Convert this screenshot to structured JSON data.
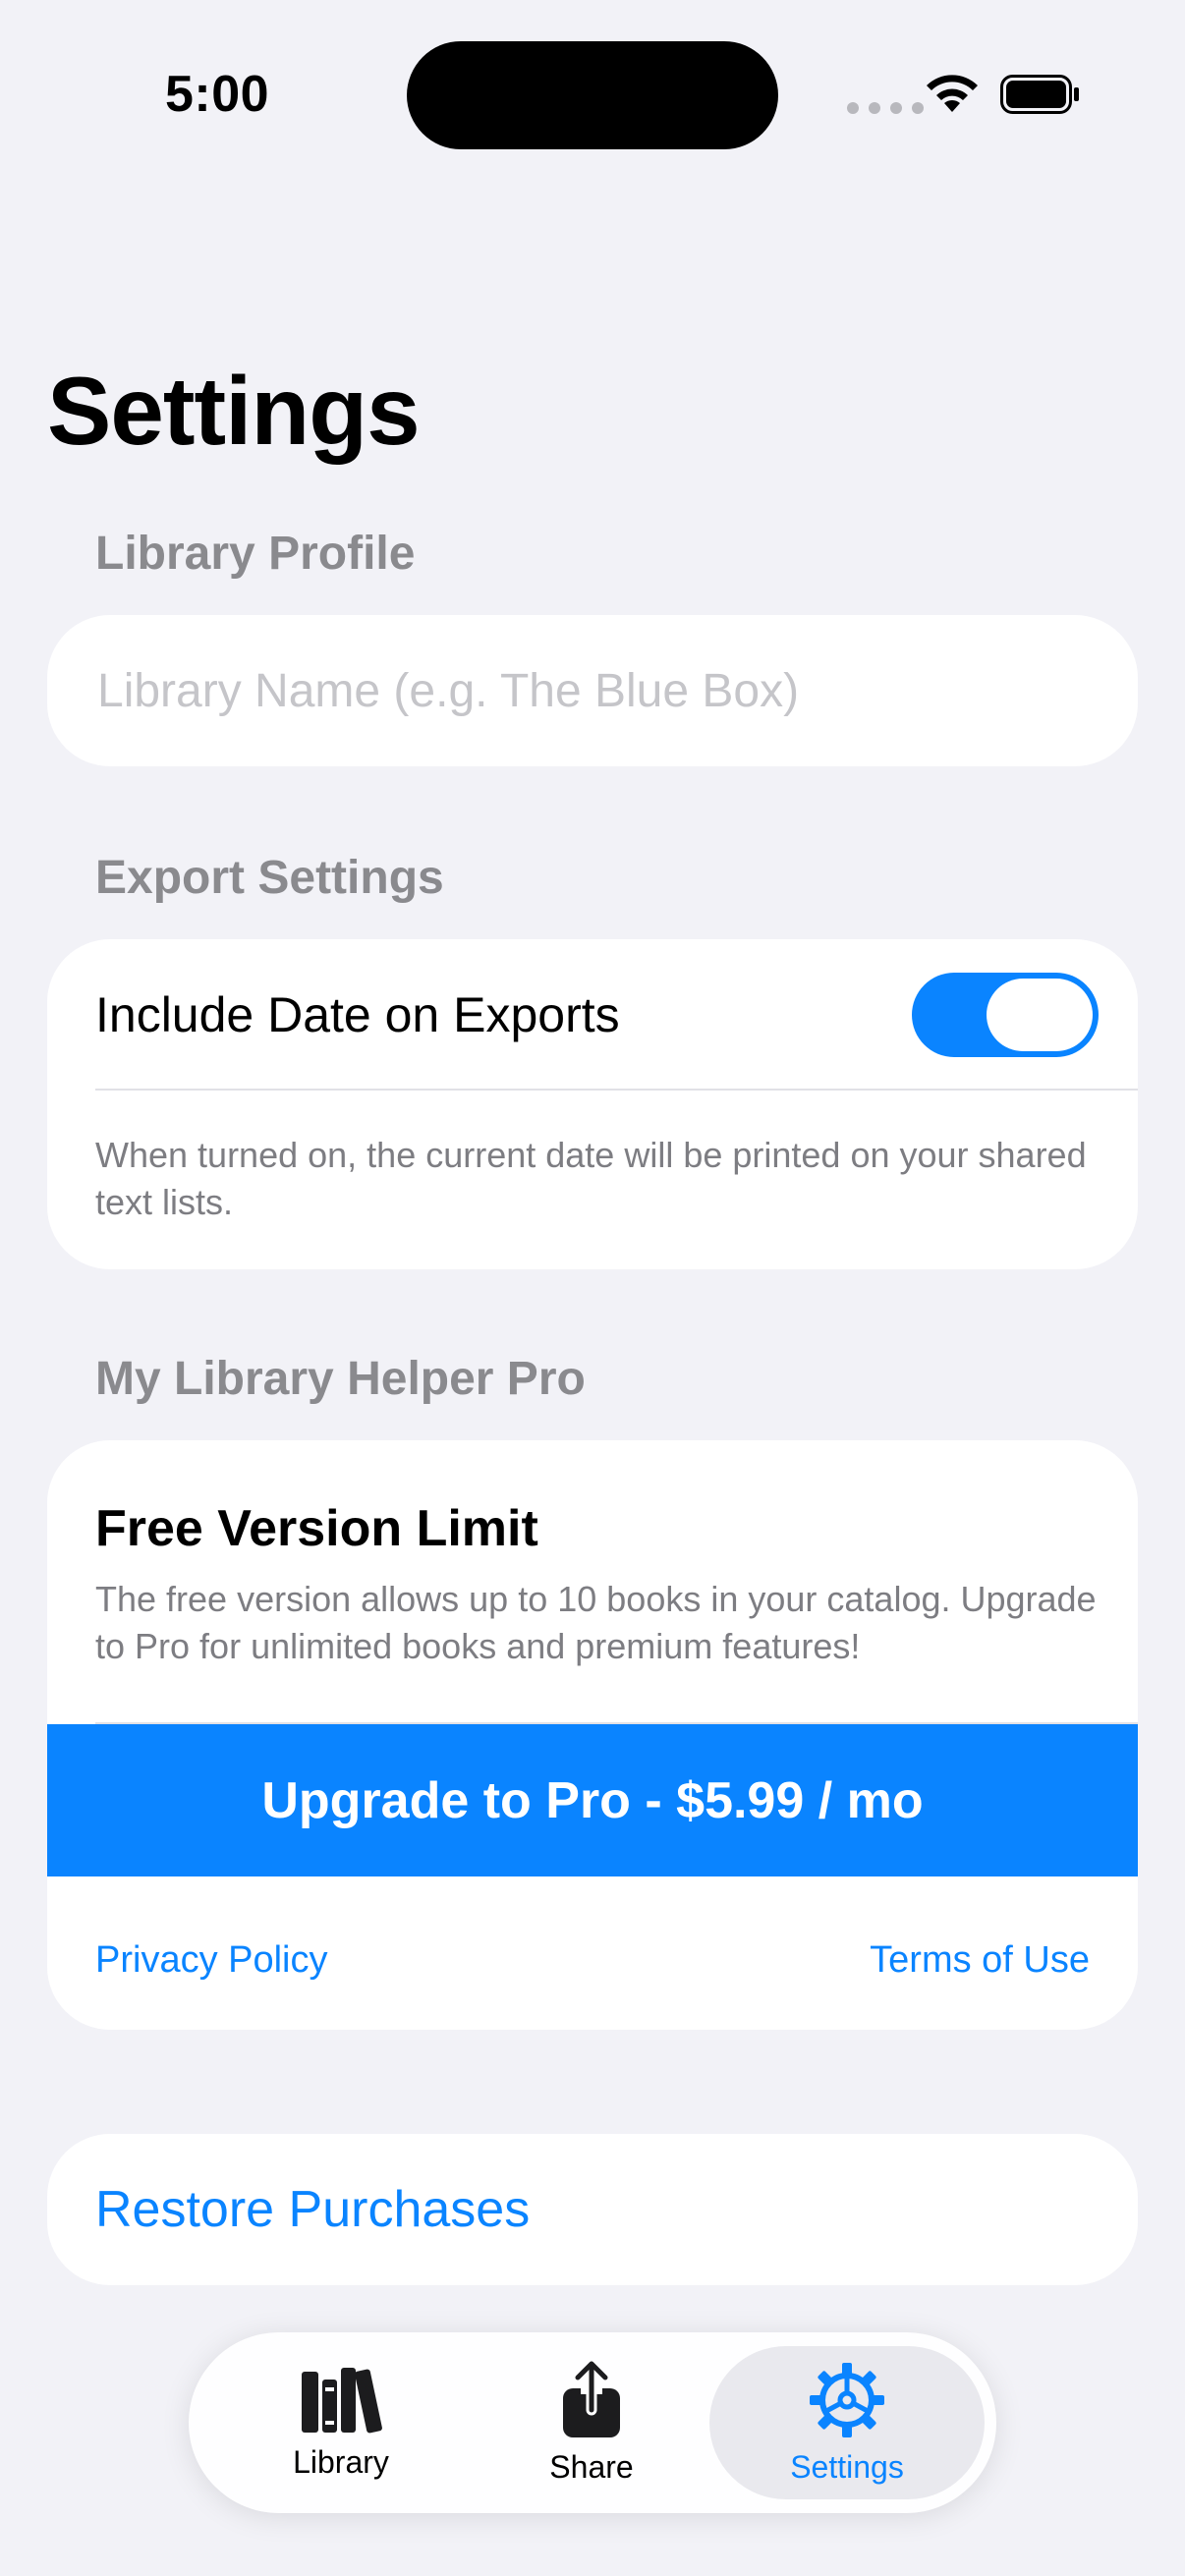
{
  "status_bar": {
    "time": "5:00"
  },
  "page": {
    "title": "Settings"
  },
  "library_profile": {
    "header": "Library Profile",
    "name_placeholder": "Library Name (e.g. The Blue Box)",
    "name_value": ""
  },
  "export_settings": {
    "header": "Export Settings",
    "include_date_label": "Include Date on Exports",
    "include_date_on": true,
    "footnote": "When turned on, the current date will be printed on your shared text lists."
  },
  "pro": {
    "header": "My Library Helper Pro",
    "title": "Free Version Limit",
    "description": "The free version allows up to 10 books in your catalog. Upgrade to Pro for unlimited books and premium features!",
    "upgrade_label": "Upgrade to Pro - $5.99 / mo",
    "privacy_label": "Privacy Policy",
    "terms_label": "Terms of Use"
  },
  "restore": {
    "label": "Restore Purchases"
  },
  "tabbar": {
    "tabs": [
      {
        "label": "Library",
        "icon": "books-icon",
        "active": false
      },
      {
        "label": "Share",
        "icon": "share-icon",
        "active": false
      },
      {
        "label": "Settings",
        "icon": "gear-icon",
        "active": true
      }
    ]
  },
  "colors": {
    "accent": "#0a84ff",
    "background": "#f2f2f7",
    "secondary_text": "#8a8a8e"
  }
}
